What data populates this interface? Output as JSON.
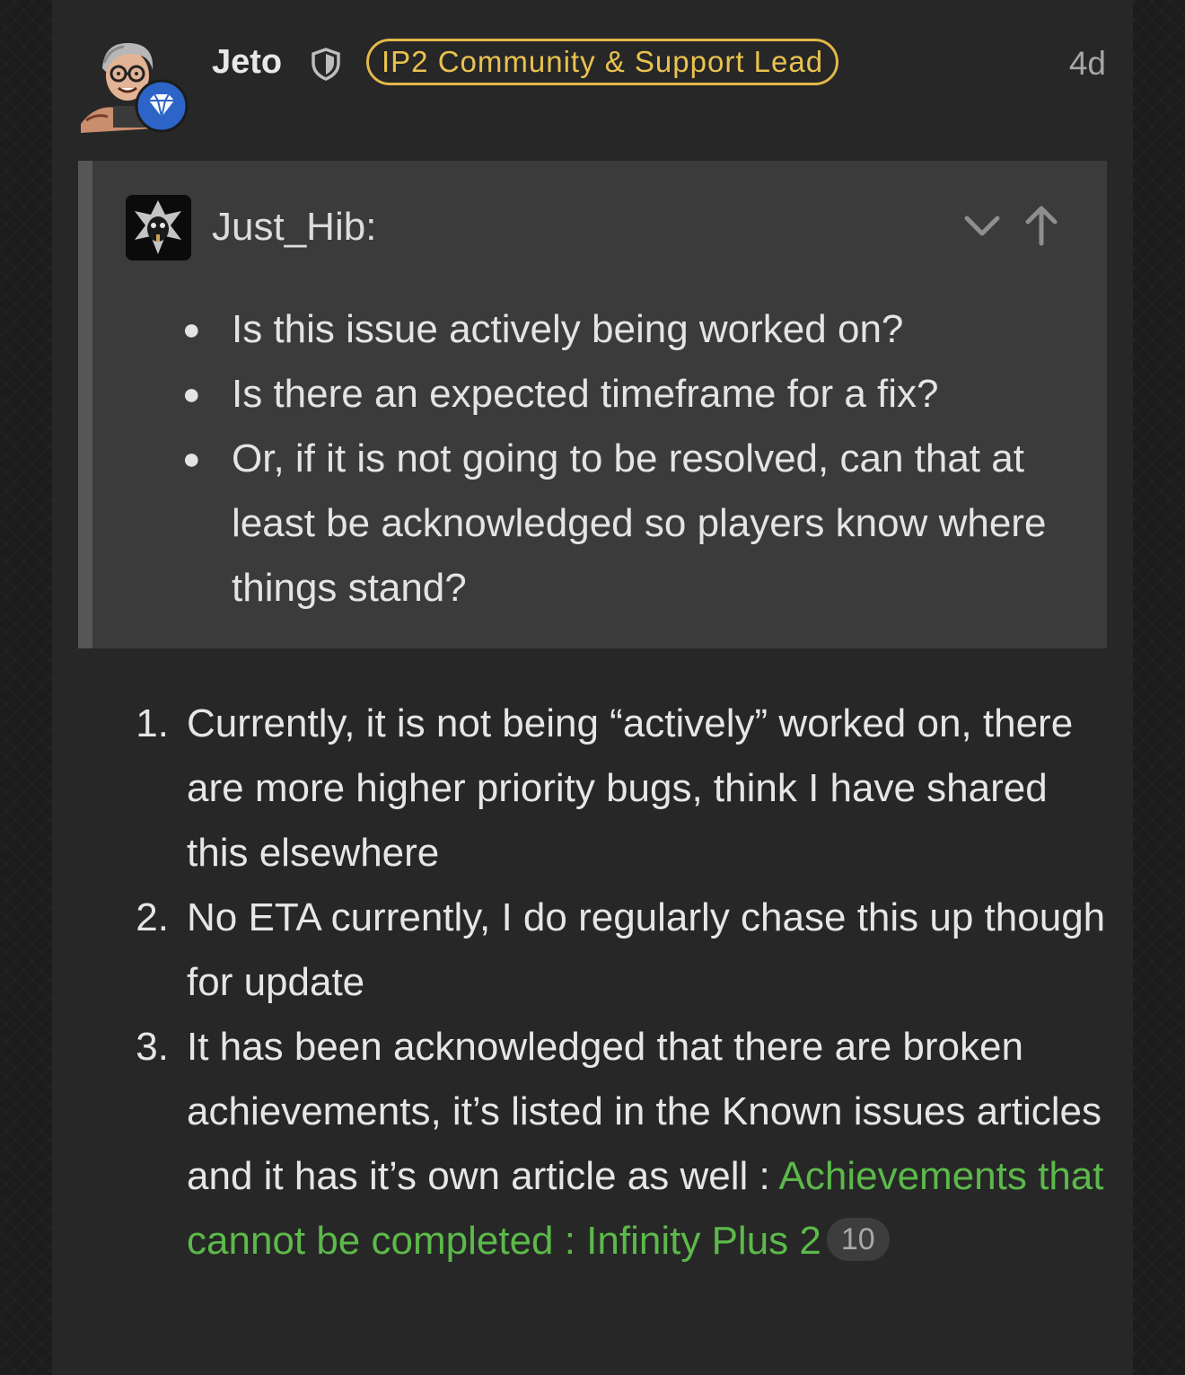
{
  "post": {
    "username": "Jeto",
    "title_badge": "IP2 Community & Support Lead",
    "age": "4d",
    "avatar_icon": "illustrated-avatar",
    "flair_icon": "diamond-icon",
    "moderator_icon": "shield-icon",
    "colors": {
      "badge": "#e2b84a",
      "link": "#5cb94a",
      "flair": "#2c64c8"
    }
  },
  "quote": {
    "author": "Just_Hib:",
    "expand_icon": "chevron-down-icon",
    "jump_icon": "arrow-up-icon",
    "items": [
      "Is this issue actively being worked on?",
      "Is there an expected timeframe for a fix?",
      "Or, if it is not going to be resolved, can that at least be acknowledged so players know where things stand?"
    ]
  },
  "answers": [
    {
      "number": "1.",
      "text": "Currently, it is not being “actively” worked on, there are more higher priority bugs, think I have shared this elsewhere"
    },
    {
      "number": "2.",
      "text": "No ETA currently, I do regularly chase this up though for update"
    },
    {
      "number": "3.",
      "text": "It has been acknowledged that there are broken achievements, it’s listed in the Known issues articles and it has it’s own article as well : ",
      "link_text": "Achievements that cannot be completed : Infinity Plus 2",
      "click_count": "10"
    }
  ]
}
